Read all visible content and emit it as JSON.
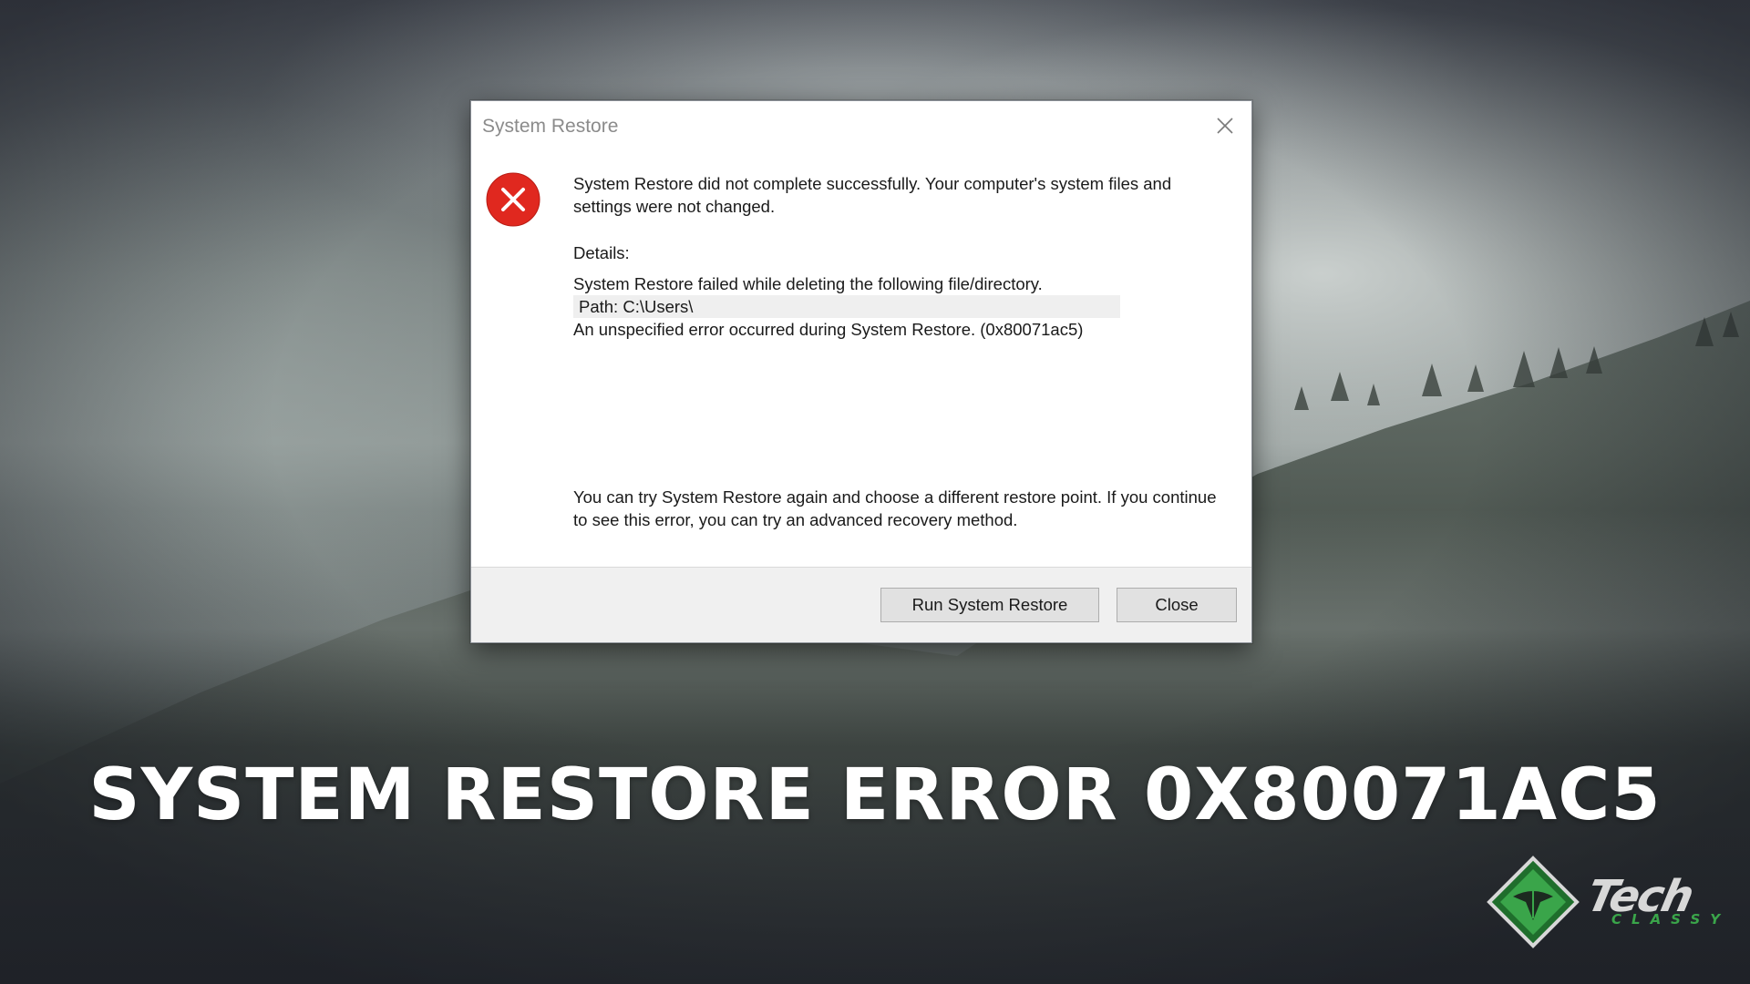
{
  "dialog": {
    "title": "System Restore",
    "message": "System Restore did not complete successfully. Your computer's system files and settings were not changed.",
    "details_label": "Details:",
    "details": [
      "System Restore failed while deleting the following file/directory.",
      "Path: C:\\Users\\",
      "An unspecified error occurred during System Restore. (0x80071ac5)"
    ],
    "hint": "You can try System Restore again and choose a different restore point. If you continue to see this error, you can try an advanced recovery method.",
    "buttons": {
      "run": "Run System Restore",
      "close": "Close"
    },
    "icons": {
      "error": "error-x-icon",
      "close": "close-icon"
    },
    "colors": {
      "error_red": "#e0281f",
      "footer_bg": "#f0f0f0",
      "button_bg": "#e1e1e1"
    }
  },
  "headline": "SYSTEM RESTORE ERROR 0X80071AC5",
  "logo": {
    "word": "Tech",
    "sub": "CLASSY",
    "colors": {
      "green": "#3aa54a",
      "dark_green": "#1f6e2c"
    }
  }
}
